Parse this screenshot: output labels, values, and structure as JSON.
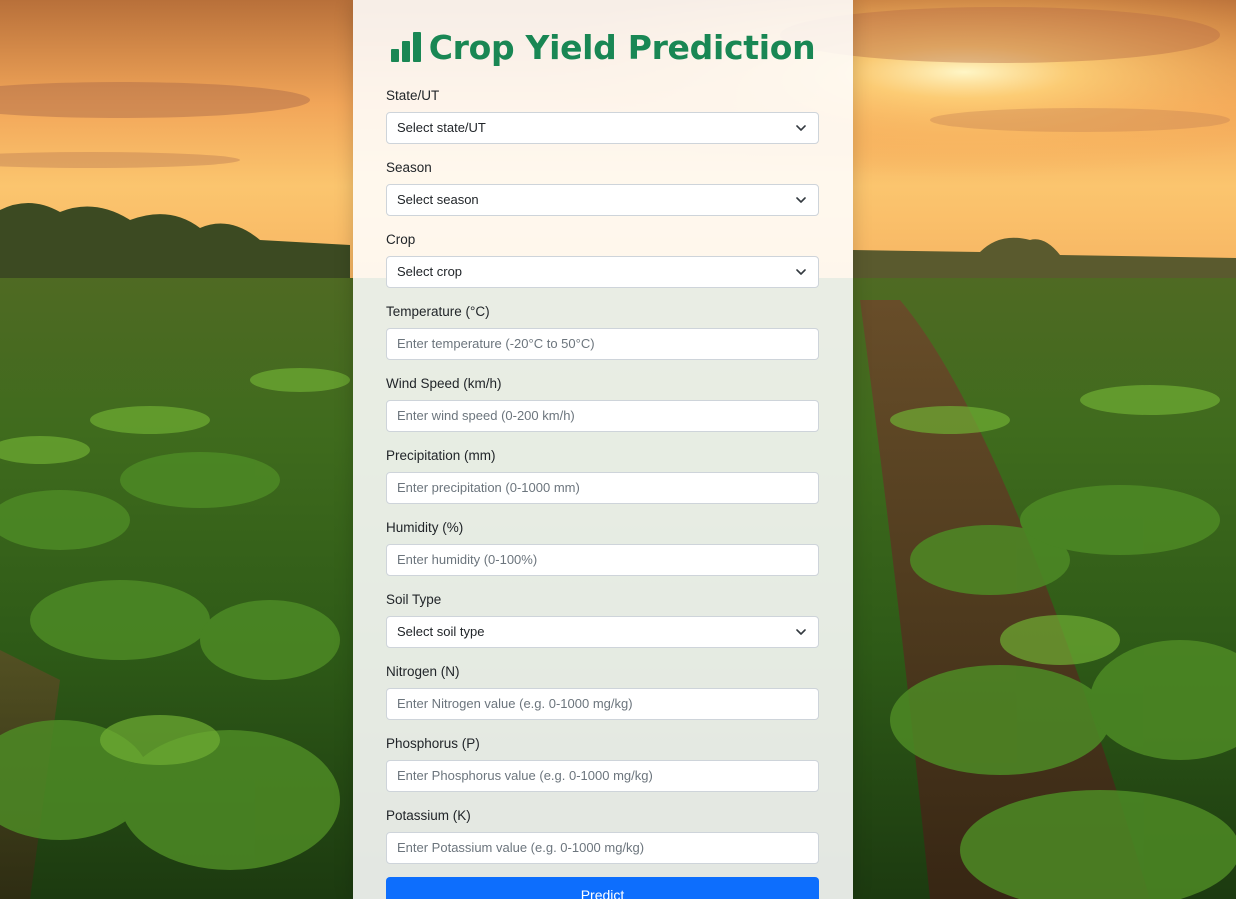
{
  "app": {
    "title": "Crop Yield Prediction",
    "title_icon": "bar-chart-icon",
    "accent_color": "#198754",
    "button_color": "#0d6efd"
  },
  "form": {
    "fields": [
      {
        "label": "State/UT",
        "type": "select",
        "value": "Select state/UT"
      },
      {
        "label": "Season",
        "type": "select",
        "value": "Select season"
      },
      {
        "label": "Crop",
        "type": "select",
        "value": "Select crop"
      },
      {
        "label": "Temperature (°C)",
        "type": "input",
        "placeholder": "Enter temperature (-20°C to 50°C)"
      },
      {
        "label": "Wind Speed (km/h)",
        "type": "input",
        "placeholder": "Enter wind speed (0-200 km/h)"
      },
      {
        "label": "Precipitation (mm)",
        "type": "input",
        "placeholder": "Enter precipitation (0-1000 mm)"
      },
      {
        "label": "Humidity (%)",
        "type": "input",
        "placeholder": "Enter humidity (0-100%)"
      },
      {
        "label": "Soil Type",
        "type": "select",
        "value": "Select soil type"
      },
      {
        "label": "Nitrogen (N)",
        "type": "input",
        "placeholder": "Enter Nitrogen value (e.g. 0-1000 mg/kg)"
      },
      {
        "label": "Phosphorus (P)",
        "type": "input",
        "placeholder": "Enter Phosphorus value (e.g. 0-1000 mg/kg)"
      },
      {
        "label": "Potassium (K)",
        "type": "input",
        "placeholder": "Enter Potassium value (e.g. 0-1000 mg/kg)"
      }
    ],
    "submit_label": "Predict"
  }
}
